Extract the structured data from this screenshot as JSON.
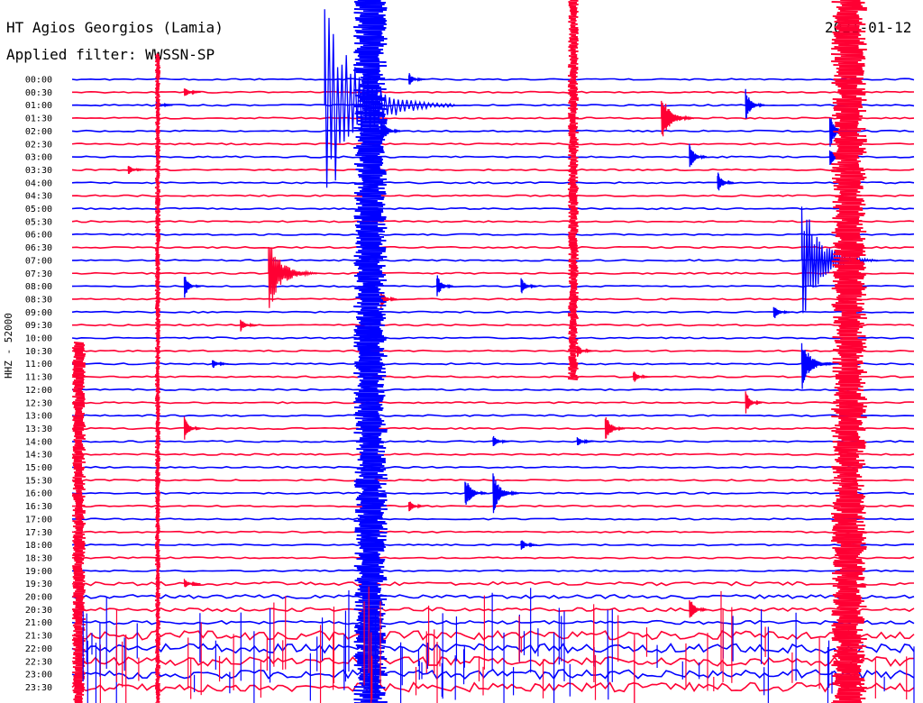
{
  "header": {
    "station": "HT Agios Georgios (Lamia)",
    "filter": "Applied filter: WWSSN-SP",
    "date": "2021-01-12"
  },
  "channel_label": "HHZ - 52000",
  "colors": {
    "blue": "#0000ff",
    "red": "#ff0033"
  },
  "chart_data": {
    "type": "line",
    "title": "HT Agios Georgios (Lamia)",
    "subtitle": "Applied filter: WWSSN-SP",
    "ylabel": "HHZ - 52000",
    "time_labels": [
      "00:00",
      "00:30",
      "01:00",
      "01:30",
      "02:00",
      "02:30",
      "03:00",
      "03:30",
      "04:00",
      "04:30",
      "05:00",
      "05:30",
      "06:00",
      "06:30",
      "07:00",
      "07:30",
      "08:00",
      "08:30",
      "09:00",
      "09:30",
      "10:00",
      "10:30",
      "11:00",
      "11:30",
      "12:00",
      "12:30",
      "13:00",
      "13:30",
      "14:00",
      "14:30",
      "15:00",
      "15:30",
      "16:00",
      "16:30",
      "17:00",
      "17:30",
      "18:00",
      "18:30",
      "19:00",
      "19:30",
      "20:00",
      "20:30",
      "21:00",
      "21:30",
      "22:00",
      "22:30",
      "23:00",
      "23:30"
    ],
    "line_colors": [
      "blue",
      "red"
    ],
    "grid": false,
    "events": [
      {
        "row": 0,
        "minute": 12,
        "amp": 8
      },
      {
        "row": 1,
        "minute": 4,
        "amp": 6
      },
      {
        "row": 2,
        "minute": 3,
        "amp": 6
      },
      {
        "row": 2,
        "minute": 24,
        "amp": 18
      },
      {
        "row": 2,
        "minute": 9,
        "amp": 120
      },
      {
        "row": 3,
        "minute": 21,
        "amp": 30
      },
      {
        "row": 4,
        "minute": 11,
        "amp": 18
      },
      {
        "row": 4,
        "minute": 27,
        "amp": 20
      },
      {
        "row": 6,
        "minute": 22,
        "amp": 16
      },
      {
        "row": 6,
        "minute": 27,
        "amp": 12
      },
      {
        "row": 7,
        "minute": 2,
        "amp": 6
      },
      {
        "row": 8,
        "minute": 23,
        "amp": 14
      },
      {
        "row": 14,
        "minute": 26,
        "amp": 70
      },
      {
        "row": 15,
        "minute": 7,
        "amp": 45
      },
      {
        "row": 16,
        "minute": 4,
        "amp": 14
      },
      {
        "row": 16,
        "minute": 13,
        "amp": 14
      },
      {
        "row": 16,
        "minute": 16,
        "amp": 10
      },
      {
        "row": 17,
        "minute": 11,
        "amp": 12
      },
      {
        "row": 18,
        "minute": 25,
        "amp": 10
      },
      {
        "row": 19,
        "minute": 6,
        "amp": 8
      },
      {
        "row": 21,
        "minute": 18,
        "amp": 8
      },
      {
        "row": 22,
        "minute": 5,
        "amp": 6
      },
      {
        "row": 22,
        "minute": 26,
        "amp": 30
      },
      {
        "row": 23,
        "minute": 20,
        "amp": 8
      },
      {
        "row": 25,
        "minute": 24,
        "amp": 14
      },
      {
        "row": 27,
        "minute": 4,
        "amp": 14
      },
      {
        "row": 27,
        "minute": 19,
        "amp": 18
      },
      {
        "row": 28,
        "minute": 15,
        "amp": 8
      },
      {
        "row": 28,
        "minute": 18,
        "amp": 6
      },
      {
        "row": 32,
        "minute": 14,
        "amp": 20
      },
      {
        "row": 32,
        "minute": 15,
        "amp": 24
      },
      {
        "row": 33,
        "minute": 12,
        "amp": 8
      },
      {
        "row": 36,
        "minute": 16,
        "amp": 8
      },
      {
        "row": 39,
        "minute": 4,
        "amp": 6
      },
      {
        "row": 41,
        "minute": 22,
        "amp": 16
      }
    ]
  }
}
